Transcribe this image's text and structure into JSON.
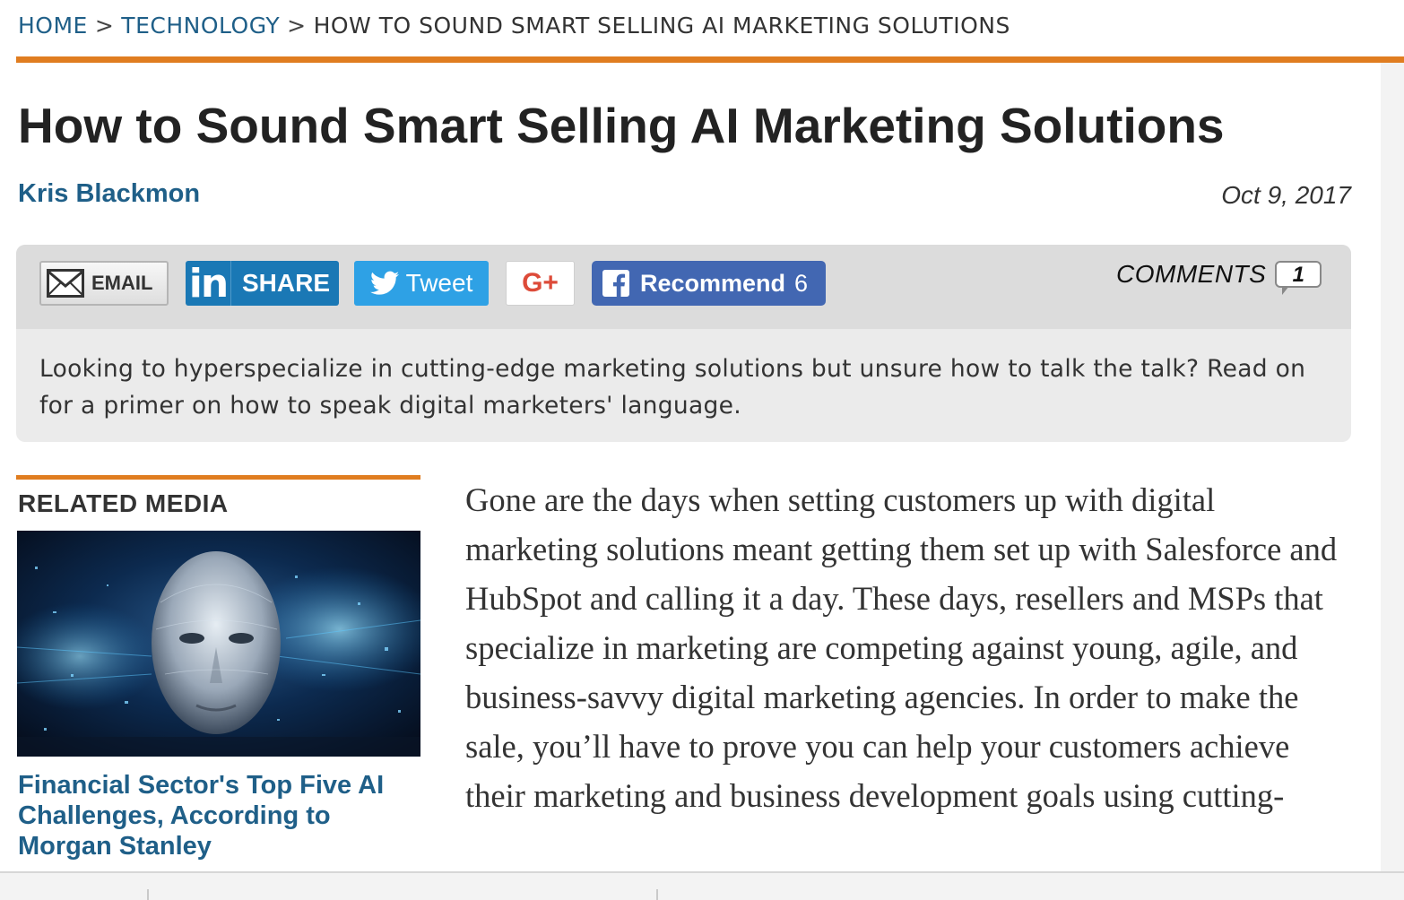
{
  "breadcrumb": {
    "home": "HOME",
    "separator": ">",
    "section": "TECHNOLOGY",
    "current": "HOW TO SOUND SMART SELLING AI MARKETING SOLUTIONS"
  },
  "article": {
    "title": "How to Sound Smart Selling AI Marketing Solutions",
    "author": "Kris Blackmon",
    "date": "Oct 9, 2017",
    "summary": "Looking to hyperspecialize in cutting-edge marketing solutions but unsure how to talk the talk? Read on for a primer on how to speak digital marketers' language.",
    "body": "Gone are the days when setting customers up with digital marketing solutions meant getting them set up with Salesforce and HubSpot and calling it a day. These days, resellers and MSPs that specialize in marketing are competing against young, agile, and business-savvy digital marketing agencies. In order to make the sale, you’ll have to prove you can help your customers achieve their marketing and business development goals using cutting-"
  },
  "share": {
    "email_label": "EMAIL",
    "linkedin_icon": "in",
    "linkedin_label": "SHARE",
    "tweet_label": "Tweet",
    "gplus_label": "G+",
    "facebook_label": "Recommend",
    "facebook_count": "6",
    "comments_label": "COMMENTS",
    "comments_count": "1"
  },
  "related": {
    "heading": "RELATED MEDIA",
    "item_title": "Financial Sector's Top Five AI Challenges, According to Morgan Stanley"
  },
  "colors": {
    "accent_orange": "#e07d20",
    "link_blue": "#1f5f88",
    "linkedin": "#1a78b5",
    "twitter": "#2ea1e5",
    "gplus": "#dd4b39",
    "facebook": "#4267b2"
  },
  "icons": [
    "envelope-icon",
    "linkedin-icon",
    "twitter-bird-icon",
    "google-plus-icon",
    "facebook-icon",
    "comment-bubble-icon"
  ]
}
